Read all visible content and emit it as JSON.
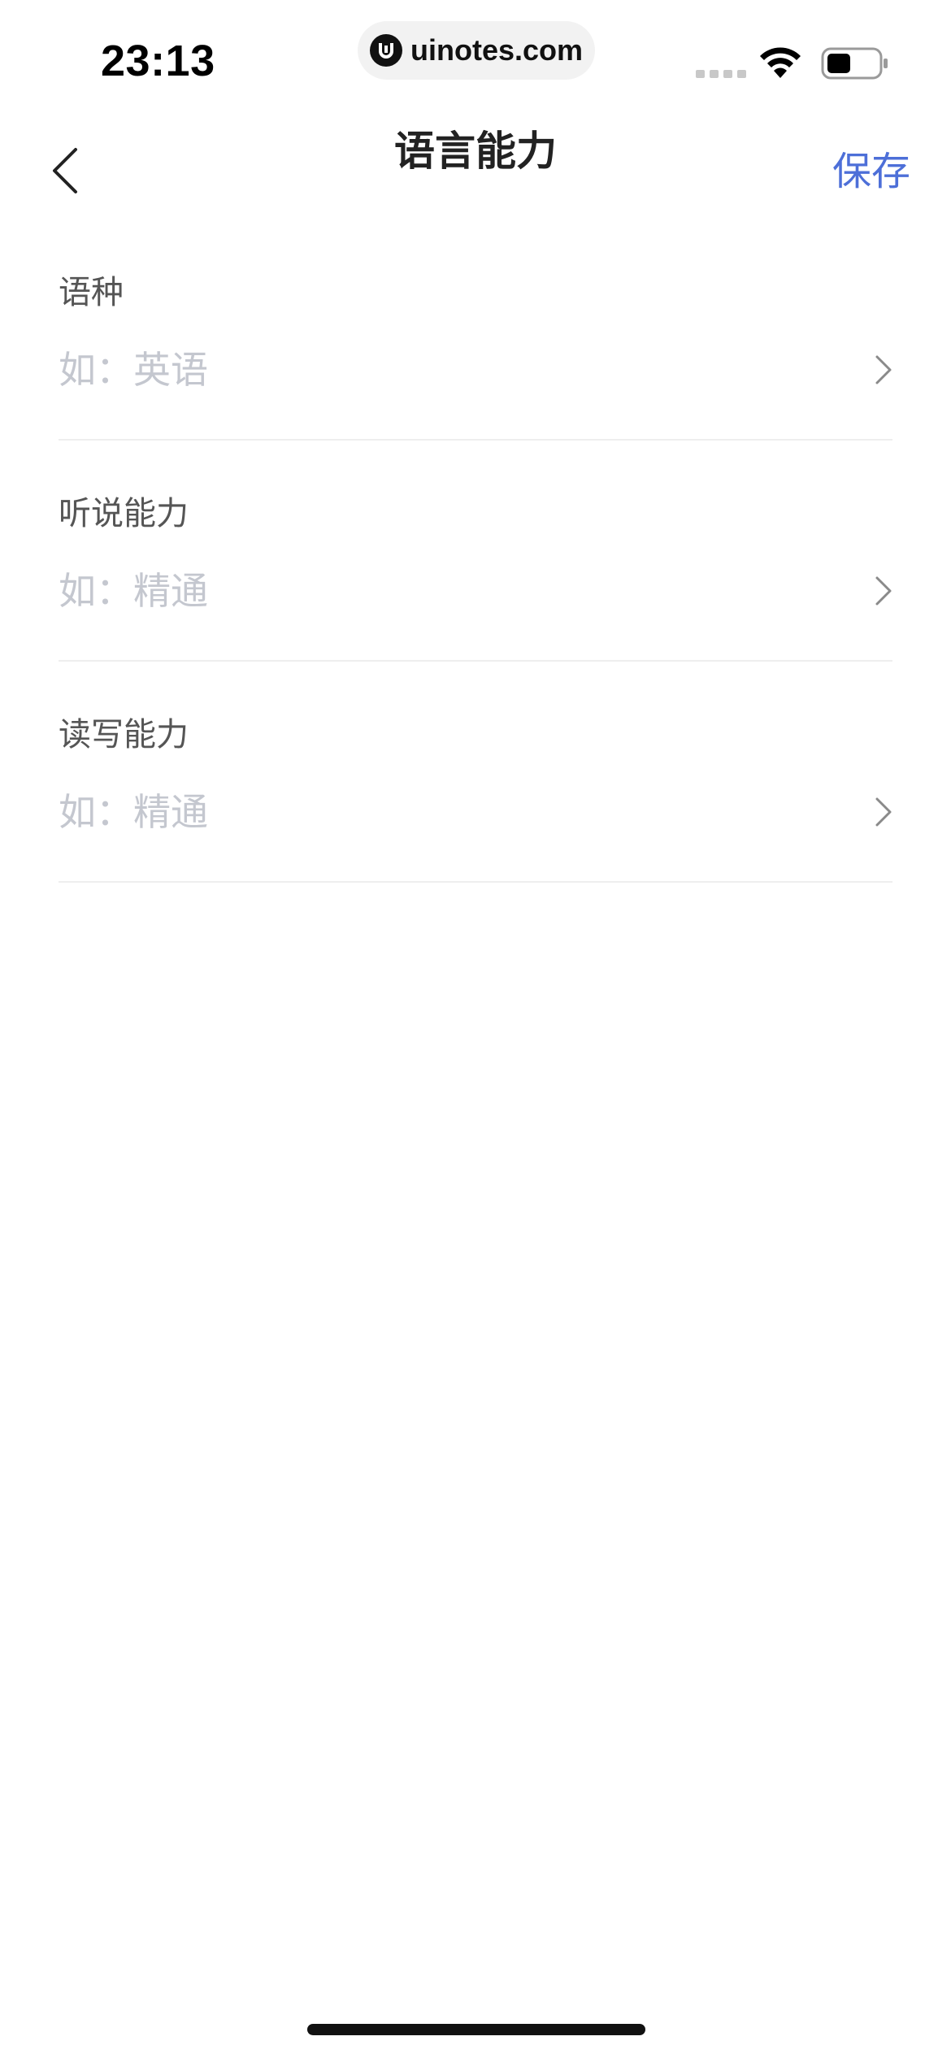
{
  "status_bar": {
    "time": "23:13",
    "url": "uinotes.com",
    "icons": [
      "signal-icon",
      "wifi-icon",
      "battery-icon"
    ]
  },
  "nav": {
    "title": "语言能力",
    "save_label": "保存",
    "back_icon": "chevron-left-icon"
  },
  "form": {
    "fields": [
      {
        "label": "语种",
        "placeholder": "如：英语"
      },
      {
        "label": "听说能力",
        "placeholder": "如：精通"
      },
      {
        "label": "读写能力",
        "placeholder": "如：精通"
      }
    ]
  },
  "colors": {
    "accent": "#4d6fd8",
    "placeholder": "#c4c7cf",
    "label": "#555555",
    "divider": "#eeeeee"
  }
}
